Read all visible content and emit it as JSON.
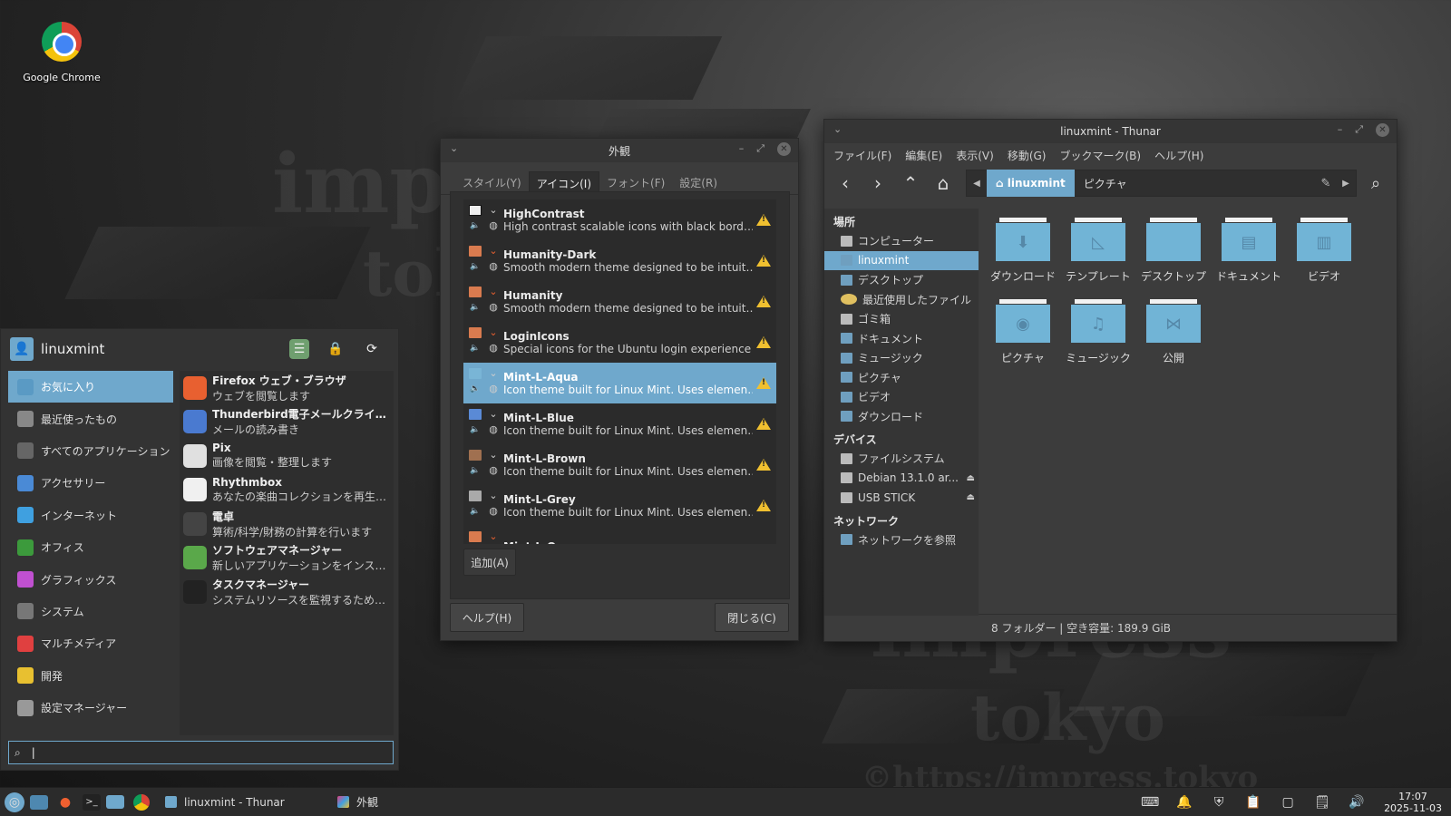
{
  "desktop": {
    "icon_label": "Google Chrome",
    "watermark": [
      "impress",
      "tokyo",
      "impress",
      "tokyo",
      "©https://impress.tokyo"
    ]
  },
  "appearance": {
    "title": "外観",
    "tabs": [
      "スタイル(Y)",
      "アイコン(I)",
      "フォント(F)",
      "設定(R)"
    ],
    "active_tab": 1,
    "themes": [
      {
        "name": "HighContrast",
        "desc": "High contrast scalable icons with black borders",
        "folder": "dark"
      },
      {
        "name": "Humanity-Dark",
        "desc": "Smooth modern theme designed to be intuitive.",
        "folder": "orange"
      },
      {
        "name": "Humanity",
        "desc": "Smooth modern theme designed to be intuitive.",
        "folder": "orange"
      },
      {
        "name": "LoginIcons",
        "desc": "Special icons for the Ubuntu login experience",
        "folder": "orange"
      },
      {
        "name": "Mint-L-Aqua",
        "desc": "Icon theme built for Linux Mint. Uses elements from Papirus.",
        "folder": "aqua",
        "selected": true
      },
      {
        "name": "Mint-L-Blue",
        "desc": "Icon theme built for Linux Mint. Uses elements from Papirus.",
        "folder": "blue"
      },
      {
        "name": "Mint-L-Brown",
        "desc": "Icon theme built for Linux Mint. Uses elements from Papirus.",
        "folder": "brown"
      },
      {
        "name": "Mint-L-Grey",
        "desc": "Icon theme built for Linux Mint. Uses elements from Papirus.",
        "folder": "grey"
      },
      {
        "name": "Mint-L-Orange",
        "desc": "",
        "folder": "orange"
      }
    ],
    "add_button": "追加(A)",
    "help_button": "ヘルプ(H)",
    "close_button": "閉じる(C)"
  },
  "thunar": {
    "title": "linuxmint - Thunar",
    "menu": [
      "ファイル(F)",
      "編集(E)",
      "表示(V)",
      "移動(G)",
      "ブックマーク(B)",
      "ヘルプ(H)"
    ],
    "path": [
      "linuxmint",
      "ピクチャ"
    ],
    "sidebar": {
      "places_header": "場所",
      "places": [
        {
          "label": "コンピューター",
          "icon": "computer-icon"
        },
        {
          "label": "linuxmint",
          "icon": "home-icon",
          "selected": true
        },
        {
          "label": "デスクトップ",
          "icon": "desktop-icon"
        },
        {
          "label": "最近使用したファイル",
          "icon": "recent-icon"
        },
        {
          "label": "ゴミ箱",
          "icon": "trash-icon"
        },
        {
          "label": "ドキュメント",
          "icon": "folder-icon"
        },
        {
          "label": "ミュージック",
          "icon": "folder-icon"
        },
        {
          "label": "ピクチャ",
          "icon": "folder-icon"
        },
        {
          "label": "ビデオ",
          "icon": "folder-icon"
        },
        {
          "label": "ダウンロード",
          "icon": "folder-icon"
        }
      ],
      "devices_header": "デバイス",
      "devices": [
        {
          "label": "ファイルシステム",
          "eject": false
        },
        {
          "label": "Debian 13.1.0 ar...",
          "eject": true
        },
        {
          "label": "USB STICK",
          "eject": true
        }
      ],
      "network_header": "ネットワーク",
      "network": [
        {
          "label": "ネットワークを参照"
        }
      ]
    },
    "files": [
      {
        "label": "ダウンロード",
        "glyph": "⬇"
      },
      {
        "label": "テンプレート",
        "glyph": "◺"
      },
      {
        "label": "デスクトップ",
        "glyph": ""
      },
      {
        "label": "ドキュメント",
        "glyph": "▤"
      },
      {
        "label": "ビデオ",
        "glyph": "▥"
      },
      {
        "label": "ピクチャ",
        "glyph": "◉"
      },
      {
        "label": "ミュージック",
        "glyph": "♫"
      },
      {
        "label": "公開",
        "glyph": "⋈"
      }
    ],
    "status": "8 フォルダー  |  空き容量: 189.9 GiB"
  },
  "startmenu": {
    "user": "linuxmint",
    "categories": [
      {
        "label": "お気に入り",
        "color": "#5a9ac4",
        "selected": true
      },
      {
        "label": "最近使ったもの",
        "color": "#888888"
      },
      {
        "label": "すべてのアプリケーション",
        "color": "#666666"
      },
      {
        "label": "アクセサリー",
        "color": "#4a8ad6"
      },
      {
        "label": "インターネット",
        "color": "#3fa0e0"
      },
      {
        "label": "オフィス",
        "color": "#3c9a3c"
      },
      {
        "label": "グラフィックス",
        "color": "#c050d0"
      },
      {
        "label": "システム",
        "color": "#777777"
      },
      {
        "label": "マルチメディア",
        "color": "#e04040"
      },
      {
        "label": "開発",
        "color": "#e8c030"
      },
      {
        "label": "設定マネージャー",
        "color": "#999999"
      }
    ],
    "apps": [
      {
        "name": "Firefox ウェブ・ブラウザ",
        "desc": "ウェブを閲覧します",
        "color": "#e86030"
      },
      {
        "name": "Thunderbird電子メールクライアント",
        "desc": "メールの読み書き",
        "color": "#4a7ad0"
      },
      {
        "name": "Pix",
        "desc": "画像を閲覧・整理します",
        "color": "#e0e0e0"
      },
      {
        "name": "Rhythmbox",
        "desc": "あなたの楽曲コレクションを再生、整理します",
        "color": "#f0f0f0"
      },
      {
        "name": "電卓",
        "desc": "算術/科学/財務の計算を行います",
        "color": "#444444"
      },
      {
        "name": "ソフトウェアマネージャー",
        "desc": "新しいアプリケーションをインストールします",
        "color": "#5aa84a"
      },
      {
        "name": "タスクマネージャー",
        "desc": "システムリソースを監視するためのツール",
        "color": "#222222"
      }
    ],
    "search_value": ""
  },
  "panel": {
    "tasks": [
      "linuxmint - Thunar",
      "外観"
    ],
    "time": "17:07",
    "date": "2025-11-03"
  }
}
